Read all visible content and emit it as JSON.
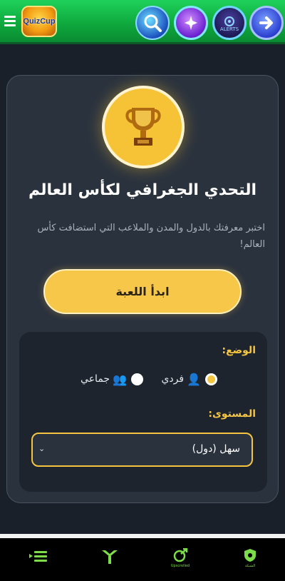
{
  "header": {
    "logo_text": "QuizCup",
    "alerts_label": "ALERTS",
    "icons": [
      "menu-icon",
      "search-icon",
      "magic-icon",
      "alerts-icon",
      "exit-icon"
    ]
  },
  "game": {
    "title": "التحدي الجغرافي لكأس العالم",
    "subtitle": "اختبر معرفتك بالدول والمدن والملاعب التي استضافت كأس العالم!",
    "start_label": "ابدأ اللعبة"
  },
  "options": {
    "mode_label": "الوضع:",
    "mode_single": "فردي",
    "mode_group": "جماعي",
    "mode_selected": "فردي",
    "level_label": "المستوى:",
    "level_value": "سهل (دول)"
  },
  "bottom_nav": {
    "items": [
      {
        "icon": "list-icon",
        "label": ""
      },
      {
        "icon": "y-logo-icon",
        "label": ""
      },
      {
        "icon": "upscrolled-icon",
        "label": "Upscrolled"
      },
      {
        "icon": "shield-icon",
        "label": "الشبكة"
      }
    ]
  },
  "colors": {
    "accent": "#f5c542",
    "background": "#19202a",
    "card": "#2a323e",
    "header_green": "#14b84a"
  }
}
